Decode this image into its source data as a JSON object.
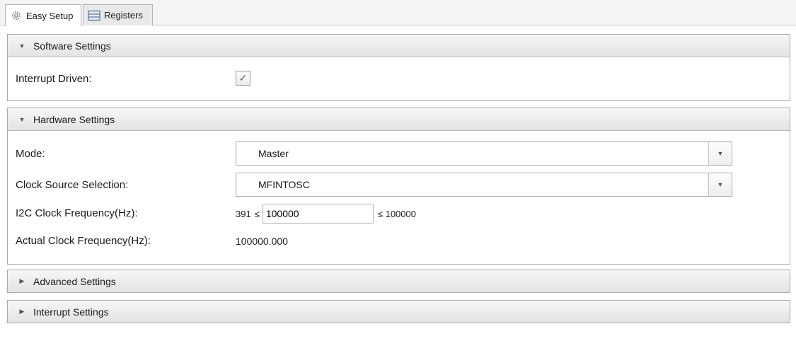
{
  "tabs": [
    {
      "label": "Easy Setup",
      "icon": "gear-icon",
      "active": true
    },
    {
      "label": "Registers",
      "icon": "registers-icon",
      "active": false
    }
  ],
  "software": {
    "title": "Software Settings",
    "interrupt_label": "Interrupt Driven:",
    "interrupt_checked": true
  },
  "hardware": {
    "title": "Hardware Settings",
    "mode_label": "Mode:",
    "mode_value": "Master",
    "clock_label": "Clock Source Selection:",
    "clock_value": "MFINTOSC",
    "i2c_label": "I2C Clock Frequency(Hz):",
    "i2c_min": "391",
    "le_symbol": "≤",
    "i2c_value": "100000",
    "i2c_max_text": "≤ 100000",
    "actual_label": "Actual Clock Frequency(Hz):",
    "actual_value": "100000.000"
  },
  "advanced": {
    "title": "Advanced Settings"
  },
  "interrupt": {
    "title": "Interrupt Settings"
  },
  "colors": {
    "panel_border": "#a9a9a9",
    "header_bg": "#e3e3e3"
  }
}
